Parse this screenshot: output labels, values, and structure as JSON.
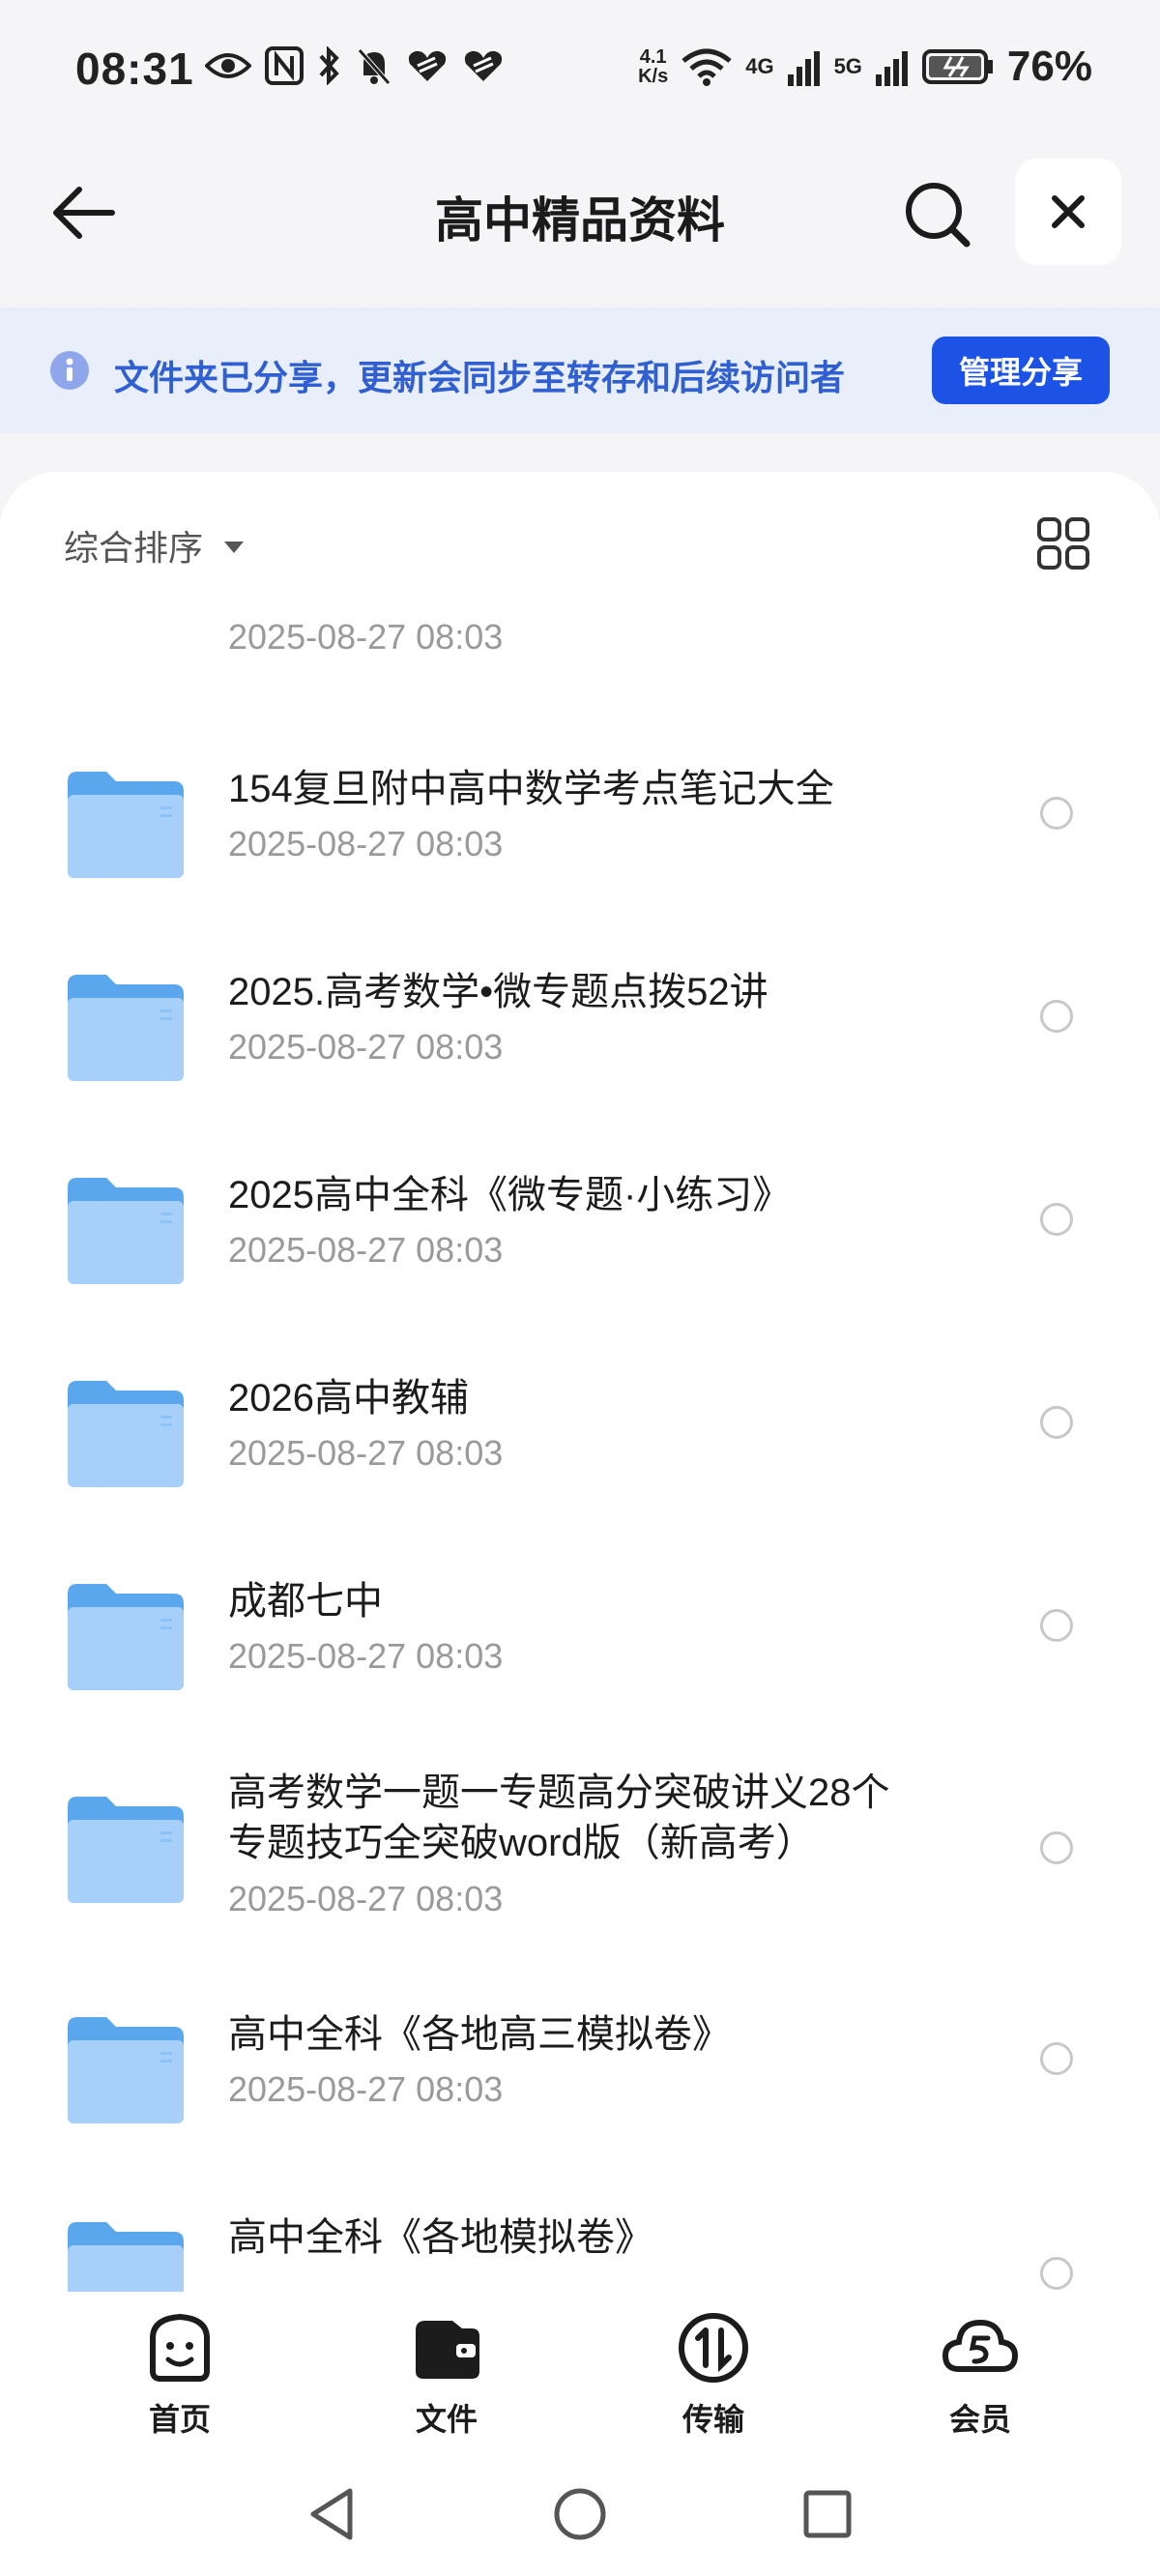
{
  "status_bar": {
    "time": "08:31",
    "speed_top": "4.1",
    "speed_bottom": "K/s",
    "net_4g": "4G",
    "net_5g": "5G",
    "battery": "76%"
  },
  "header": {
    "title": "高中精品资料"
  },
  "banner": {
    "message": "文件夹已分享，更新会同步至转存和后续访问者",
    "button": "管理分享"
  },
  "sort": {
    "label": "综合排序"
  },
  "files": [
    {
      "name": "",
      "date": "2025-08-27 08:03"
    },
    {
      "name": "154复旦附中高中数学考点笔记大全",
      "date": "2025-08-27 08:03"
    },
    {
      "name": "2025.高考数学•微专题点拨52讲",
      "date": "2025-08-27 08:03"
    },
    {
      "name": "2025高中全科《微专题·小练习》",
      "date": "2025-08-27 08:03"
    },
    {
      "name": "2026高中教辅",
      "date": "2025-08-27 08:03"
    },
    {
      "name": "成都七中",
      "date": "2025-08-27 08:03"
    },
    {
      "name": "高考数学一题一专题高分突破讲义28个专题技巧全突破word版（新高考）",
      "date": "2025-08-27 08:03"
    },
    {
      "name": "高中全科《各地高三模拟卷》",
      "date": "2025-08-27 08:03"
    },
    {
      "name": "高中全科《各地模拟卷》",
      "date": ""
    }
  ],
  "bottom_nav": [
    {
      "label": "首页",
      "icon": "home-face-icon"
    },
    {
      "label": "文件",
      "icon": "wallet-folder-icon"
    },
    {
      "label": "传输",
      "icon": "transfer-icon"
    },
    {
      "label": "会员",
      "icon": "cloud-vip-icon"
    }
  ],
  "colors": {
    "accent": "#1d52e6",
    "banner_bg": "#e9eefb",
    "banner_text": "#2f5fd1",
    "folder": "#8cc3f7"
  }
}
